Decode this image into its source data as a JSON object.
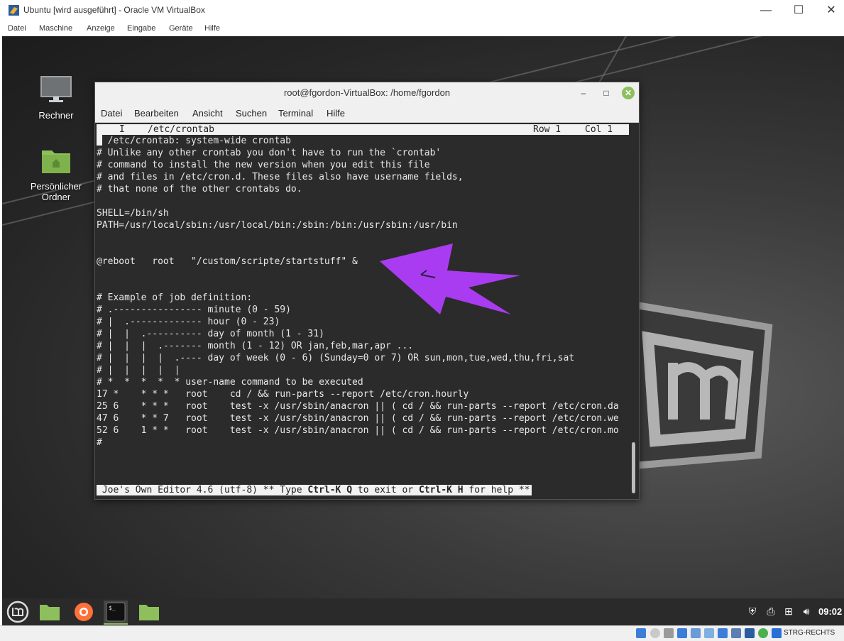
{
  "host_window": {
    "title": "Ubuntu [wird ausgeführt] - Oracle VM VirtualBox",
    "controls": {
      "minimize": "—",
      "maximize": "☐",
      "close": "✕"
    },
    "menu": [
      "Datei",
      "Maschine",
      "Anzeige",
      "Eingabe",
      "Geräte",
      "Hilfe"
    ]
  },
  "desktop": {
    "icons": [
      {
        "label": "Rechner",
        "icon": "monitor-icon"
      },
      {
        "label": "Persönlicher Ordner",
        "icon": "home-folder-icon"
      }
    ]
  },
  "terminal": {
    "title": "root@fgordon-VirtualBox: /home/fgordon",
    "controls": {
      "minimize": "–",
      "maximize": "□",
      "close": "✕"
    },
    "menu": [
      "Datei",
      "Bearbeiten",
      "Ansicht",
      "Suchen",
      "Terminal",
      "Hilfe"
    ],
    "editor": {
      "status_mode": "I",
      "status_file": "/etc/crontab",
      "status_row": "Row 1",
      "status_col": "Col 1",
      "lines": [
        "# /etc/crontab: system-wide crontab",
        "# Unlike any other crontab you don't have to run the `crontab'",
        "# command to install the new version when you edit this file",
        "# and files in /etc/cron.d. These files also have username fields,",
        "# that none of the other crontabs do.",
        "",
        "SHELL=/bin/sh",
        "PATH=/usr/local/sbin:/usr/local/bin:/sbin:/bin:/usr/sbin:/usr/bin",
        "",
        "",
        "@reboot   root   \"/custom/scripte/startstuff\" &",
        "",
        "",
        "# Example of job definition:",
        "# .---------------- minute (0 - 59)",
        "# |  .------------- hour (0 - 23)",
        "# |  |  .---------- day of month (1 - 31)",
        "# |  |  |  .------- month (1 - 12) OR jan,feb,mar,apr ...",
        "# |  |  |  |  .---- day of week (0 - 6) (Sunday=0 or 7) OR sun,mon,tue,wed,thu,fri,sat",
        "# |  |  |  |  |",
        "# *  *  *  *  * user-name command to be executed",
        "17 *    * * *   root    cd / && run-parts --report /etc/cron.hourly",
        "25 6    * * *   root    test -x /usr/sbin/anacron || ( cd / && run-parts --report /etc/cron.da",
        "47 6    * * 7   root    test -x /usr/sbin/anacron || ( cd / && run-parts --report /etc/cron.we",
        "52 6    1 * *   root    test -x /usr/sbin/anacron || ( cd / && run-parts --report /etc/cron.mo",
        "#"
      ],
      "help_prefix": " Joe's Own Editor 4.6 (utf-8) ** Type ",
      "help_key1": "Ctrl-K Q",
      "help_mid": " to exit or ",
      "help_key2": "Ctrl-K H",
      "help_suffix": " for help **"
    }
  },
  "taskbar": {
    "buttons": [
      "mint-menu-icon",
      "files-icon",
      "firefox-icon",
      "terminal-icon",
      "folder-icon"
    ],
    "clock": "09:02"
  },
  "vbox_statusbar": {
    "host_key": "STRG-RECHTS"
  },
  "colors": {
    "annotation_arrow": "#a93cf0",
    "mint_green": "#8dbf5c",
    "terminal_bg": "#2b2b2b"
  }
}
